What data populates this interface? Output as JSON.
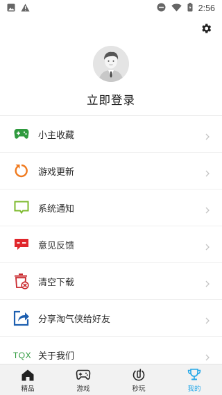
{
  "status_bar": {
    "time": "2:56",
    "icons": [
      "image-icon",
      "warning-icon",
      "dnd-icon",
      "wifi-icon",
      "battery-icon"
    ]
  },
  "header": {
    "settings_icon": "gear-icon"
  },
  "profile": {
    "login_text": "立即登录"
  },
  "menu": {
    "items": [
      {
        "label": "小主收藏",
        "icon": "gamepad-icon",
        "color": "#2f9a3e"
      },
      {
        "label": "游戏更新",
        "icon": "refresh-icon",
        "color": "#f07a1e"
      },
      {
        "label": "系统通知",
        "icon": "chat-icon",
        "color": "#7cba2c"
      },
      {
        "label": "意见反馈",
        "icon": "feedback-icon",
        "color": "#e0262b"
      },
      {
        "label": "清空下载",
        "icon": "trash-icon",
        "color": "#c9282d"
      },
      {
        "label": "分享淘气侠给好友",
        "icon": "share-icon",
        "color": "#1d5fb0"
      },
      {
        "label": "关于我们",
        "icon_text": "TQX",
        "icon": "tqx-logo-icon",
        "color": "#2f9a3e"
      }
    ]
  },
  "bottom_nav": {
    "tabs": [
      {
        "label": "精品",
        "icon": "home-icon"
      },
      {
        "label": "游戏",
        "icon": "gamepad-icon"
      },
      {
        "label": "秒玩",
        "icon": "quick-play-icon"
      },
      {
        "label": "我的",
        "icon": "trophy-icon",
        "active": true
      }
    ],
    "active_color": "#23a7e8"
  }
}
